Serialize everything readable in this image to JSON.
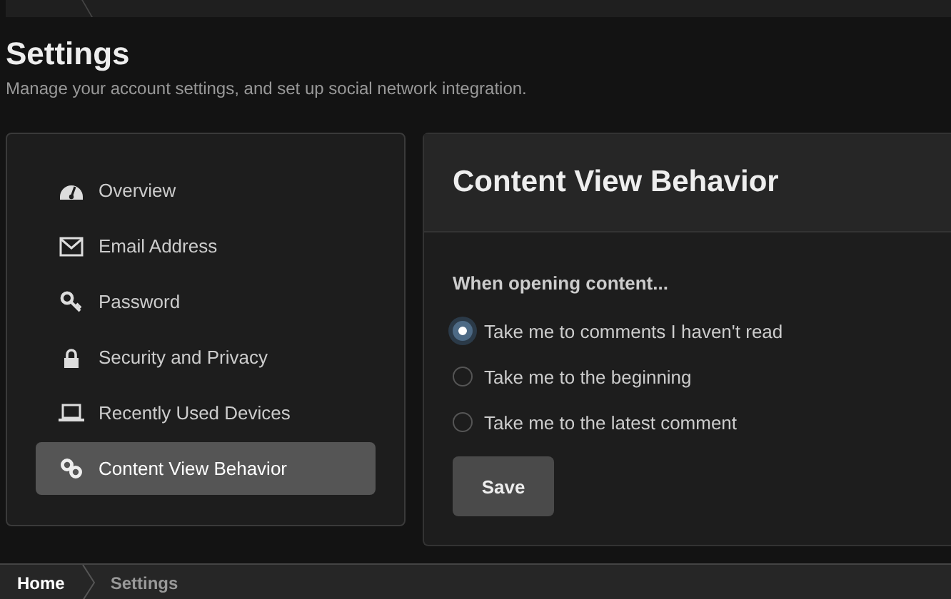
{
  "page": {
    "title": "Settings",
    "description": "Manage your account settings, and set up social network integration."
  },
  "sidebar": {
    "items": [
      {
        "label": "Overview",
        "selected": false
      },
      {
        "label": "Email Address",
        "selected": false
      },
      {
        "label": "Password",
        "selected": false
      },
      {
        "label": "Security and Privacy",
        "selected": false
      },
      {
        "label": "Recently Used Devices",
        "selected": false
      },
      {
        "label": "Content View Behavior",
        "selected": true
      }
    ]
  },
  "panel": {
    "title": "Content View Behavior",
    "question": "When opening content...",
    "options": [
      {
        "label": "Take me to comments I haven't read",
        "selected": true
      },
      {
        "label": "Take me to the beginning",
        "selected": false
      },
      {
        "label": "Take me to the latest comment",
        "selected": false
      }
    ],
    "save_button": "Save"
  },
  "breadcrumb": [
    {
      "label": "Home",
      "selected": true
    },
    {
      "label": "Settings",
      "selected": false
    }
  ]
}
